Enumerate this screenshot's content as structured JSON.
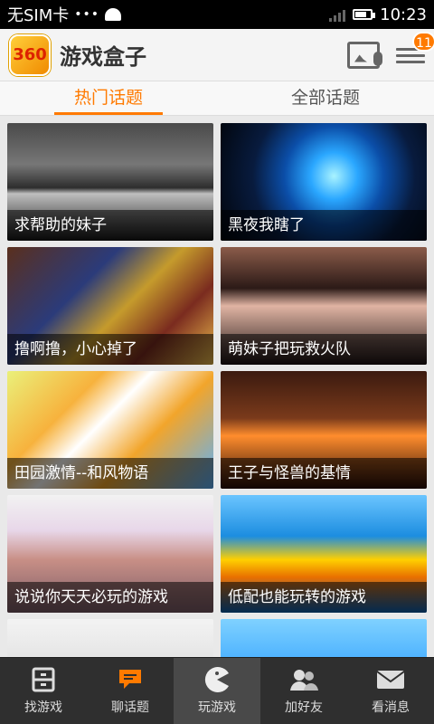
{
  "status_bar": {
    "sim": "无SIM卡",
    "dots": "•••",
    "time": "10:23"
  },
  "app_bar": {
    "logo_text": "360",
    "title": "游戏盒子",
    "badge": "11"
  },
  "tabs": [
    {
      "label": "热门话题",
      "active": true
    },
    {
      "label": "全部话题",
      "active": false
    }
  ],
  "topics": [
    {
      "title": "求帮助的妹子",
      "bg": "linear-gradient(180deg,#4a4a4a 0%,#777 35%,#2d2d2d 55%,#bfbfbf 60%,#151515 100%)"
    },
    {
      "title": "黑夜我瞎了",
      "bg": "radial-gradient(circle at 55% 45%,#a9f3ff 0%,#2aa7ff 18%,#0b4ea8 38%,#081b3e 62%,#010409 100%)"
    },
    {
      "title": "撸啊撸，小心掉了",
      "bg": "linear-gradient(135deg,#5a2f1d 0%,#2b3b7a 35%,#c59b2c 55%,#7a2b1f 75%,#f0c04d 100%)"
    },
    {
      "title": "萌妹子把玩救火队",
      "bg": "linear-gradient(180deg,#8b5c4a 0%,#2c1a17 35%,#e0b4a3 50%,#1e1414 100%)"
    },
    {
      "title": "田园激情--和风物语",
      "bg": "linear-gradient(135deg,#eaf07a 0%,#f7b23d 30%,#ffffff 45%,#f2a52b 65%,#5bb2ff 100%)"
    },
    {
      "title": "王子与怪兽的基情",
      "bg": "linear-gradient(180deg,#3b1a0f 0%,#7a3a1b 40%,#ff8d2d 55%,#2a0d06 100%)"
    },
    {
      "title": "说说你天天必玩的游戏",
      "bg": "linear-gradient(180deg,#f2f2f2 0%,#e8d7e9 30%,#c88f86 55%,#7a5b66 100%)"
    },
    {
      "title": "低配也能玩转的游戏",
      "bg": "linear-gradient(180deg,#6bc5ff 0%,#1c8de0 35%,#ffd000 55%,#e86f00 70%,#0a5fb0 100%)"
    },
    {
      "title": "",
      "bg": "linear-gradient(180deg,#f3f3f3 0%,#dcdcdc 55%,#b0b0b0 100%)"
    },
    {
      "title": "",
      "bg": "linear-gradient(180deg,#7fd1ff 0%,#2fa0ff 55%,#145fb0 100%)"
    }
  ],
  "bottom_nav": [
    {
      "label": "找游戏",
      "icon": "cabinet-icon",
      "active": false
    },
    {
      "label": "聊话题",
      "icon": "chat-icon",
      "active": false
    },
    {
      "label": "玩游戏",
      "icon": "pacman-icon",
      "active": true
    },
    {
      "label": "加好友",
      "icon": "friends-icon",
      "active": false
    },
    {
      "label": "看消息",
      "icon": "mail-icon",
      "active": false
    }
  ],
  "colors": {
    "accent": "#ff7a00"
  }
}
